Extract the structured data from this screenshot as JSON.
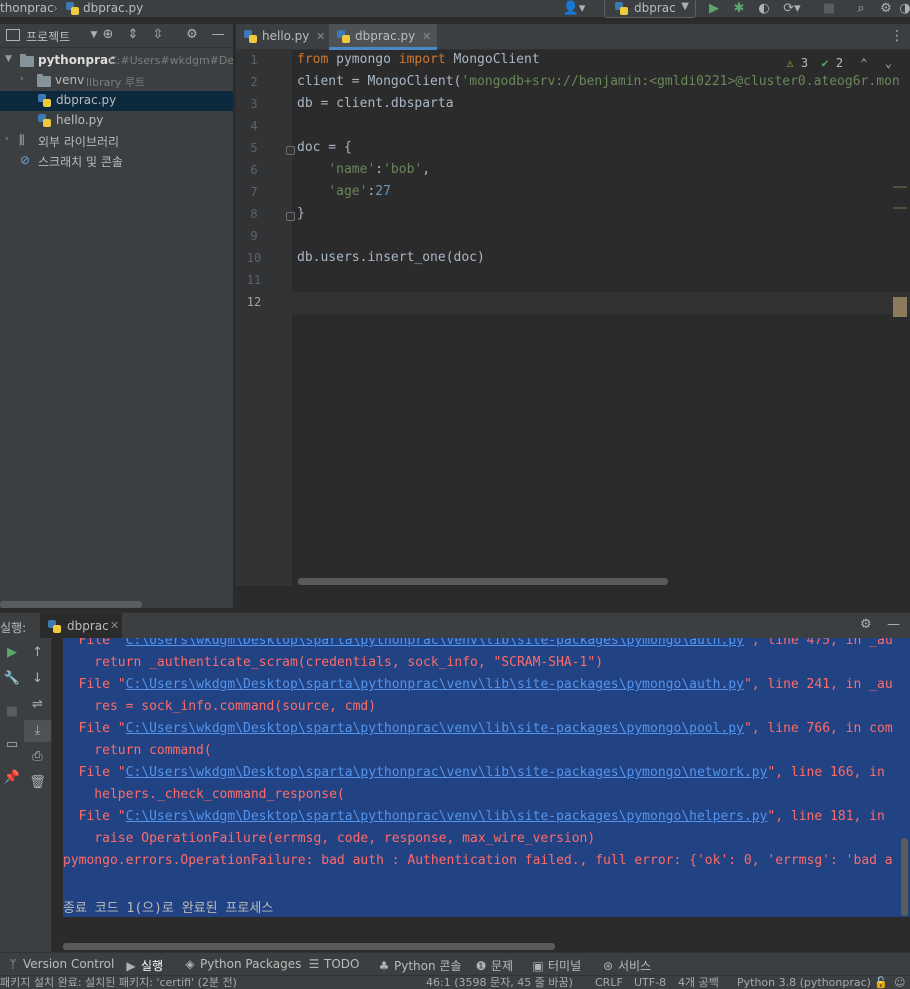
{
  "navbar": {
    "project_crumb": "thonprac",
    "file_crumb": "dbprac.py",
    "run_config": "dbprac"
  },
  "project_panel": {
    "title": "프로젝트",
    "tree": [
      {
        "label": "pythonprac",
        "sub": "C:#Users#wkdgm#Des"
      },
      {
        "label": "venv",
        "sub": "library 루트"
      },
      {
        "label": "dbprac.py",
        "sub": ""
      },
      {
        "label": "hello.py",
        "sub": ""
      },
      {
        "label": "외부 라이브러리",
        "sub": ""
      },
      {
        "label": "스크래치 및 콘솔",
        "sub": ""
      }
    ]
  },
  "tabs": [
    {
      "label": "hello.py"
    },
    {
      "label": "dbprac.py"
    }
  ],
  "editor": {
    "line_numbers": [
      "1",
      "2",
      "3",
      "4",
      "5",
      "6",
      "7",
      "8",
      "9",
      "10",
      "11",
      "12"
    ],
    "current_line": "12",
    "inspections": {
      "warnings": "3",
      "weak_warnings": "2"
    },
    "code": {
      "l1_kw1": "from",
      "l1_mod": " pymongo ",
      "l1_kw2": "import",
      "l1_cls": " MongoClient",
      "l2_a": "client = MongoClient(",
      "l2_str": "'mongodb+srv://benjamin:<gmldi0221>@cluster0.ateog6r.mon",
      "l3": "db = client.dbsparta",
      "l5": "doc = {",
      "l6_str1": "'name'",
      "l6_colon": ":",
      "l6_str2": "'bob'",
      "l6_comma": ",",
      "l7_str": "'age'",
      "l7_colon": ":",
      "l7_num": "27",
      "l8": "}",
      "l10": "db.users.insert_one(doc)"
    }
  },
  "run_panel": {
    "label": "실행:",
    "tab": "dbprac",
    "console": [
      {
        "pre": "  File \"",
        "link": "C:\\Users\\wkdgm\\Desktop\\sparta\\pythonprac\\venv\\lib\\site-packages\\pymongo\\auth.py",
        "post": "\", line 475, in _au"
      },
      {
        "text": "    return _authenticate_scram(credentials, sock_info, \"SCRAM-SHA-1\")"
      },
      {
        "pre": "  File \"",
        "link": "C:\\Users\\wkdgm\\Desktop\\sparta\\pythonprac\\venv\\lib\\site-packages\\pymongo\\auth.py",
        "post": "\", line 241, in _au"
      },
      {
        "text": "    res = sock_info.command(source, cmd)"
      },
      {
        "pre": "  File \"",
        "link": "C:\\Users\\wkdgm\\Desktop\\sparta\\pythonprac\\venv\\lib\\site-packages\\pymongo\\pool.py",
        "post": "\", line 766, in com"
      },
      {
        "text": "    return command("
      },
      {
        "pre": "  File \"",
        "link": "C:\\Users\\wkdgm\\Desktop\\sparta\\pythonprac\\venv\\lib\\site-packages\\pymongo\\network.py",
        "post": "\", line 166, in "
      },
      {
        "text": "    helpers._check_command_response("
      },
      {
        "pre": "  File \"",
        "link": "C:\\Users\\wkdgm\\Desktop\\sparta\\pythonprac\\venv\\lib\\site-packages\\pymongo\\helpers.py",
        "post": "\", line 181, in "
      },
      {
        "text": "    raise OperationFailure(errmsg, code, response, max_wire_version)"
      },
      {
        "text": "pymongo.errors.OperationFailure: bad auth : Authentication failed., full error: {'ok': 0, 'errmsg': 'bad a"
      }
    ],
    "exit_message": "종료 코드 1(으)로 완료된 프로세스"
  },
  "bottom_tools": [
    {
      "label": "Version Control"
    },
    {
      "label": "실행"
    },
    {
      "label": "Python Packages"
    },
    {
      "label": "TODO"
    },
    {
      "label": "Python 콘솔"
    },
    {
      "label": "문제"
    },
    {
      "label": "터미널"
    },
    {
      "label": "서비스"
    }
  ],
  "statusbar": {
    "message": "패키지 설치 완료: 설치된 패키지: 'certifi' (2분 전)",
    "position": "46:1 (3598 문자, 45 줄 바꿈)",
    "line_sep": "CRLF",
    "encoding": "UTF-8",
    "indent": "4개 공백",
    "interpreter": "Python 3.8 (pythonprac)"
  }
}
